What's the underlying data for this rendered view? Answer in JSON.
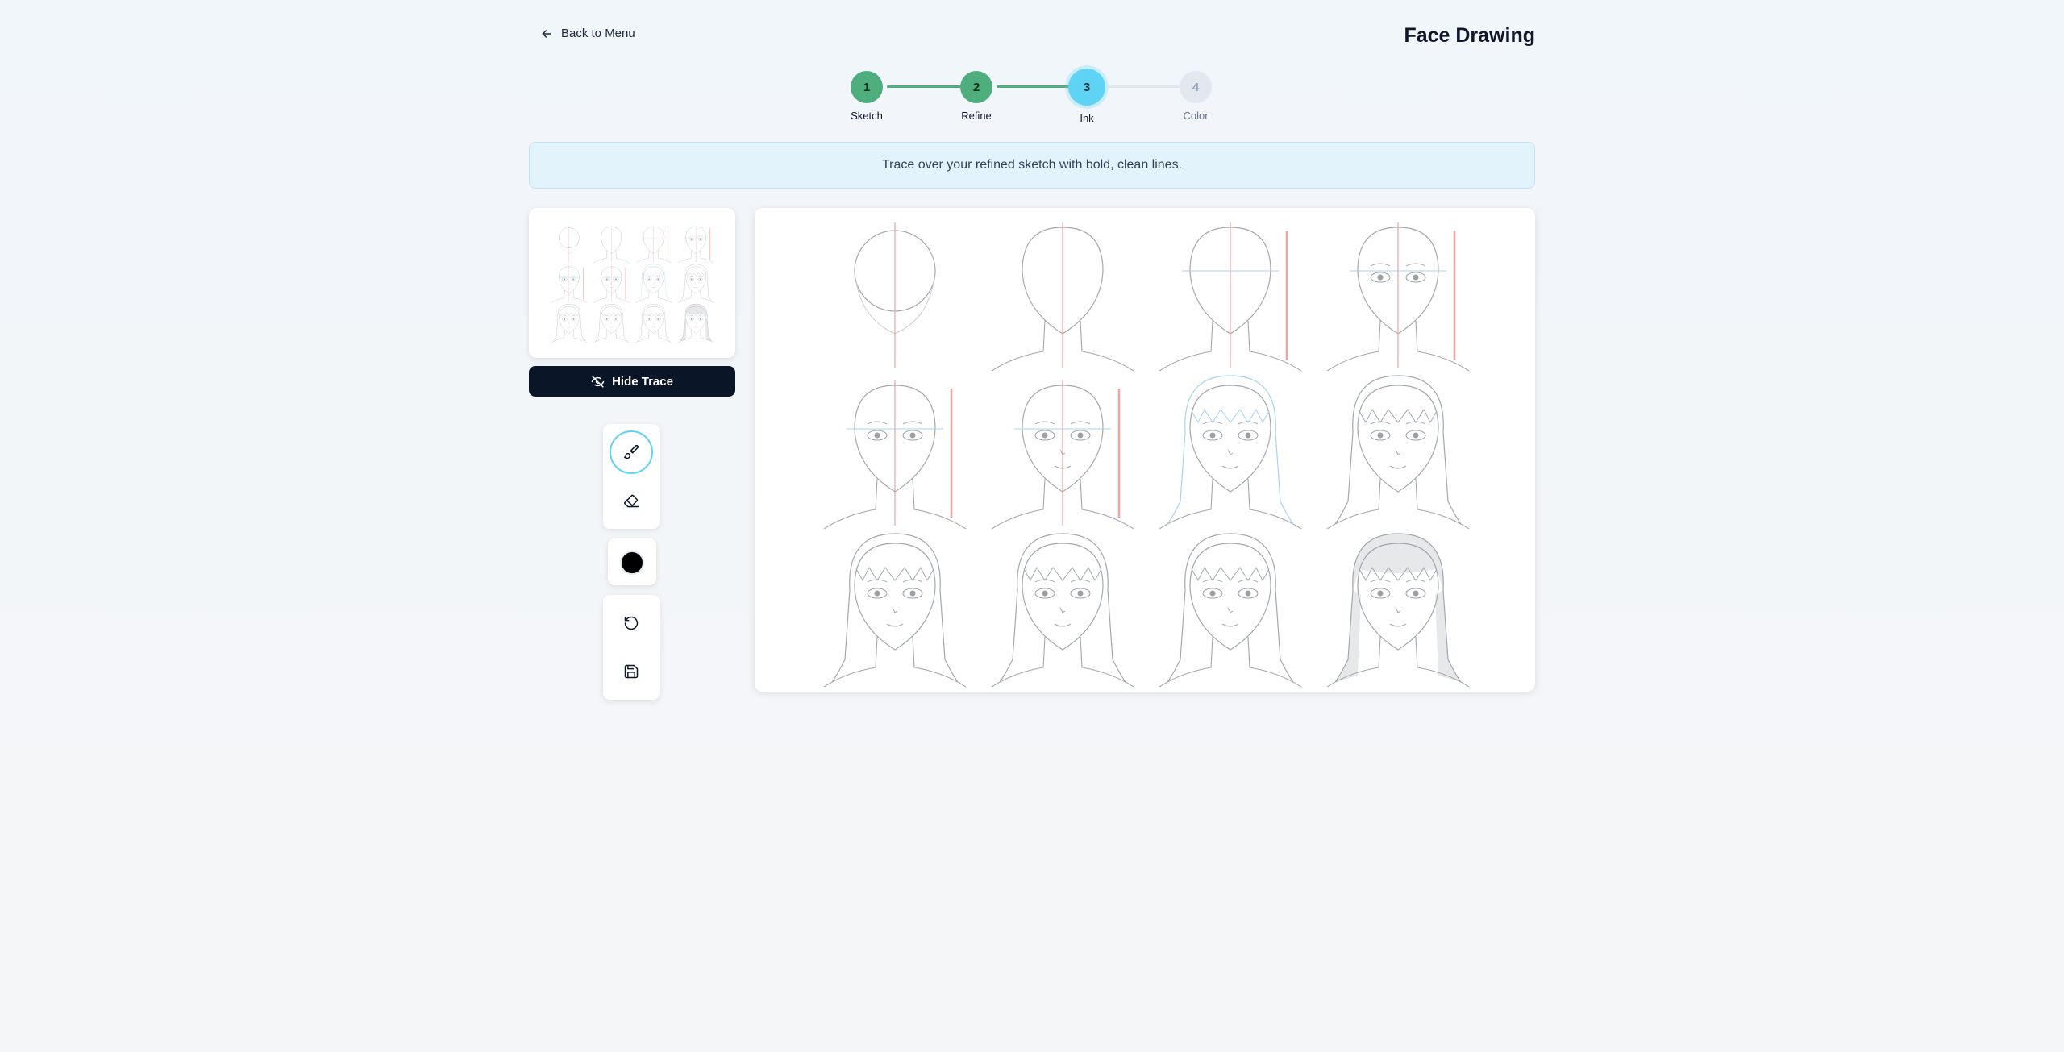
{
  "header": {
    "back_label": "Back to Menu",
    "title": "Face Drawing"
  },
  "stepper": {
    "current_step": 3,
    "steps": [
      {
        "number": "1",
        "label": "Sketch",
        "status": "done"
      },
      {
        "number": "2",
        "label": "Refine",
        "status": "done"
      },
      {
        "number": "3",
        "label": "Ink",
        "status": "active"
      },
      {
        "number": "4",
        "label": "Color",
        "status": "todo"
      }
    ]
  },
  "instruction": "Trace over your refined sketch with bold, clean lines.",
  "controls": {
    "hide_trace_label": "Hide Trace",
    "tools": [
      {
        "name": "brush",
        "icon": "paintbrush-icon",
        "active": true
      },
      {
        "name": "eraser",
        "icon": "eraser-icon",
        "active": false
      }
    ],
    "current_color": "#000000",
    "actions": [
      {
        "name": "undo",
        "icon": "undo-icon"
      },
      {
        "name": "save",
        "icon": "save-icon"
      }
    ]
  },
  "colors": {
    "done": "#4fae7e",
    "active": "#5fd3f3",
    "todo": "#e2e8ee",
    "button_dark": "#0b1528",
    "banner_bg": "#e3f3fb"
  },
  "reference_image": {
    "description_icon": "face-drawing-steps-image",
    "panels": 12,
    "rows": 3,
    "columns": 4
  }
}
